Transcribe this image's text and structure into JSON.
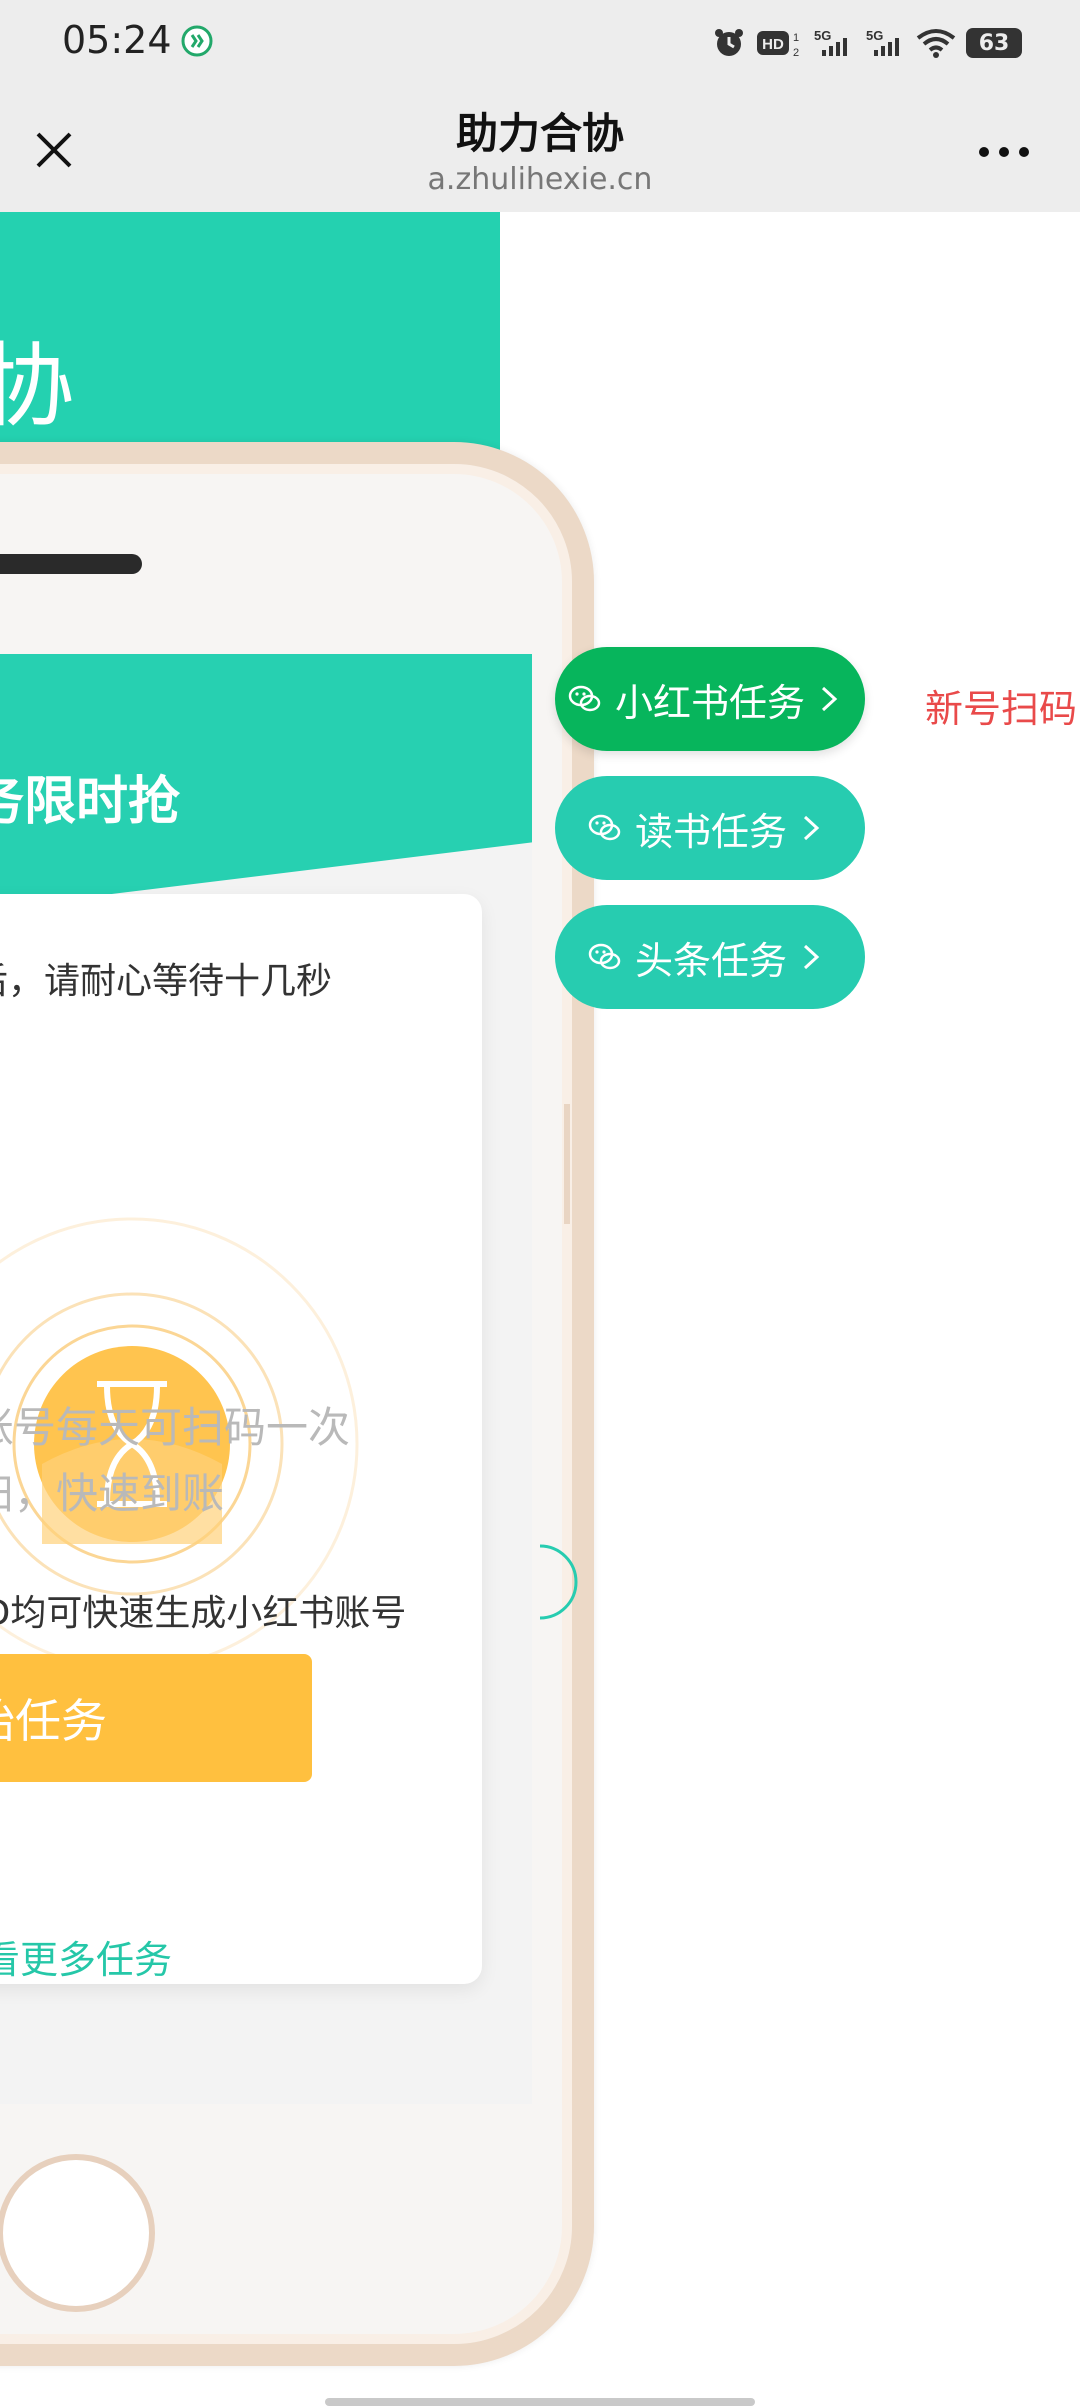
{
  "status_bar": {
    "time": "05:24",
    "battery": "63",
    "icons": [
      "alarm-icon",
      "hd-icon",
      "signal-5g-icon",
      "signal-5g-icon",
      "wifi-icon",
      "battery-icon"
    ]
  },
  "title_bar": {
    "title": "助力合协",
    "subtitle": "a.zhulihexie.cn"
  },
  "header": {
    "title_fragment": "协"
  },
  "phone_screen": {
    "title": "务限时抢",
    "hint": "后，请耐心等待十几秒",
    "desc_line1": "账号每天可扫码一次",
    "desc_line2": "扫，快速到账",
    "note": "ID均可快速生成小红书账号",
    "start_button": "开始任务",
    "more_tasks": "看更多任务"
  },
  "tasks": [
    {
      "label": "小红书任务",
      "color": "#07b55c"
    },
    {
      "label": "读书任务",
      "color": "#27ccb0"
    },
    {
      "label": "头条任务",
      "color": "#27ccb0"
    }
  ],
  "side_note": "新号扫码"
}
